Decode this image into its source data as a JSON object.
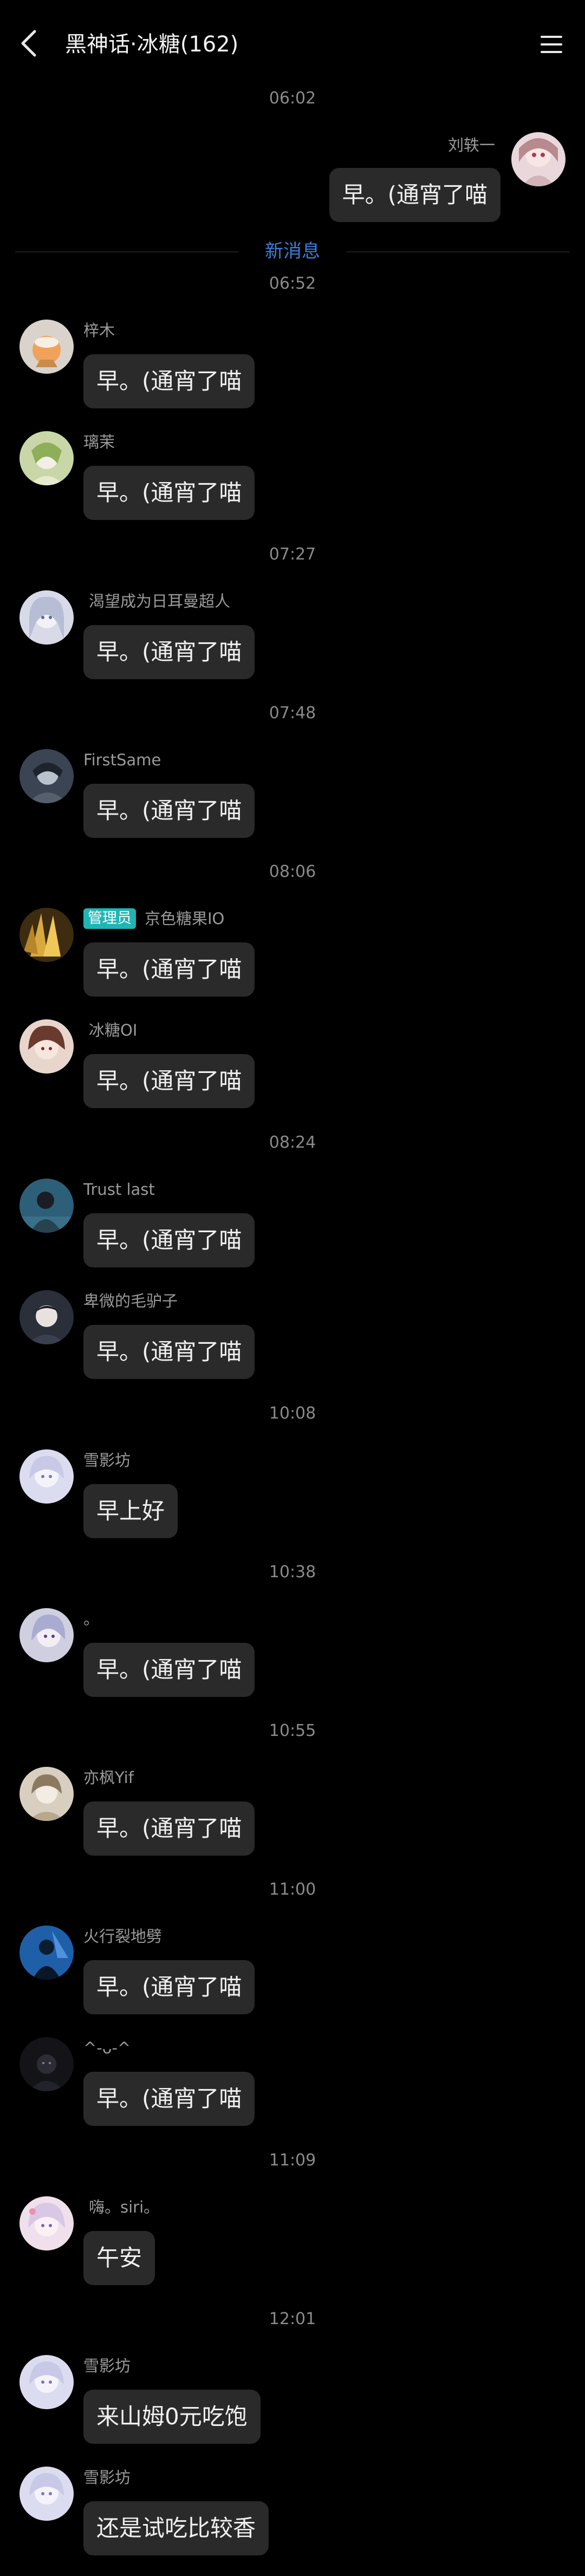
{
  "header": {
    "title": "黑神话·冰糖(162)",
    "back_icon": "chevron-left-icon",
    "menu_icon": "hamburger-menu-icon"
  },
  "colors": {
    "background": "#000000",
    "bubble": "#2a2a2a",
    "accent": "#3b7fd8",
    "admin_badge": "#1fb5b5"
  },
  "new_messages_label": "新消息",
  "timestamps": [
    "06:02",
    "06:52",
    "07:27",
    "07:48",
    "08:06",
    "08:24",
    "10:08",
    "10:38",
    "10:55",
    "11:00",
    "11:09",
    "12:01"
  ],
  "messages": [
    {
      "sender": "刘轶一",
      "text": "早。(通宵了喵",
      "side": "right"
    },
    {
      "sender": "梓木",
      "text": "早。(通宵了喵",
      "side": "left"
    },
    {
      "sender": "璃茉",
      "text": "早。(通宵了喵",
      "side": "left"
    },
    {
      "sender": "渴望成为日耳曼超人",
      "text": "早。(通宵了喵",
      "side": "left"
    },
    {
      "sender": "FirstSame",
      "text": "早。(通宵了喵",
      "side": "left"
    },
    {
      "sender": "京色糖果IO",
      "role": "管理员",
      "text": "早。(通宵了喵",
      "side": "left"
    },
    {
      "sender": "冰糖OI",
      "text": "早。(通宵了喵",
      "side": "left"
    },
    {
      "sender": "Trust last",
      "text": "早。(通宵了喵",
      "side": "left"
    },
    {
      "sender": "卑微的毛驴子",
      "text": "早。(通宵了喵",
      "side": "left"
    },
    {
      "sender": "雪影坊",
      "text": "早上好",
      "side": "left"
    },
    {
      "sender": "。",
      "text": "早。(通宵了喵",
      "side": "left"
    },
    {
      "sender": "亦枫Yif",
      "text": "早。(通宵了喵",
      "side": "left"
    },
    {
      "sender": "火行裂地劈",
      "text": "早。(通宵了喵",
      "side": "left"
    },
    {
      "sender": "^-ᴗ-^",
      "text": "早。(通宵了喵",
      "side": "left"
    },
    {
      "sender": "嗨。siri。",
      "text": "午安",
      "side": "left"
    },
    {
      "sender": "雪影坊",
      "text": "来山姆0元吃饱",
      "side": "left"
    },
    {
      "sender": "雪影坊",
      "text": "还是试吃比较香",
      "side": "left"
    }
  ]
}
